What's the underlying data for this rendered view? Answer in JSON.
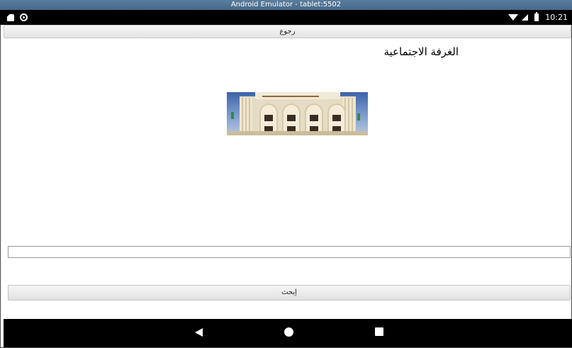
{
  "window": {
    "title": "Android Emulator - tablet:5502"
  },
  "status_bar": {
    "time": "10:21",
    "icons": [
      "sd-card-icon",
      "circle-notification-icon",
      "wifi-icon",
      "signal-icon",
      "battery-icon"
    ]
  },
  "toolbar": {
    "back_label": "رجوع"
  },
  "main": {
    "title": "الغرفة الاجتماعية",
    "image": {
      "name": "supreme-court-building-photo"
    },
    "search": {
      "value": "",
      "placeholder": ""
    },
    "search_button_label": "إبحث"
  },
  "nav_bar": {
    "icons": [
      "back-icon",
      "home-icon",
      "recents-icon"
    ]
  },
  "colors": {
    "title_bar": "#4f7293",
    "status_bar": "#000000",
    "nav_bar": "#000000",
    "button_bg": "#eeeeee"
  }
}
